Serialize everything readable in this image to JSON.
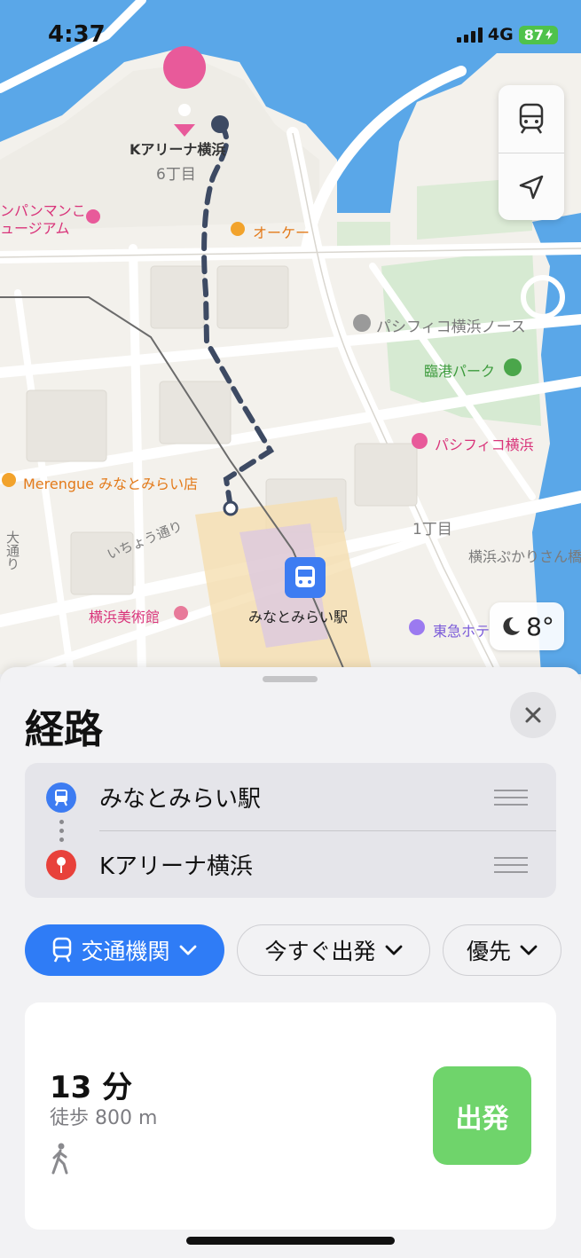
{
  "status_bar": {
    "time": "4:37",
    "network": "4G",
    "battery": "87"
  },
  "map": {
    "labels": {
      "arena": "Kアリーナ横浜",
      "block6": "6丁目",
      "museum_anpanman": "ンパンマンこ\nュージアム",
      "okay": "オーケー",
      "pacifico_north": "パシフィコ横浜ノース",
      "rinko_park": "臨港パーク",
      "pacifico": "パシフィコ横浜",
      "merengue": "Merengue みなとみらい店",
      "ichou_dori": "いちょう通り",
      "block1": "1丁目",
      "pukari": "横浜ぷかりさん橋",
      "art_museum": "横浜美術館",
      "station": "みなとみらい駅",
      "tokyu": "東急ホテ",
      "oodori": "大通り"
    },
    "weather": "8°"
  },
  "sheet": {
    "title": "経路",
    "route": {
      "from": "みなとみらい駅",
      "to": "Kアリーナ横浜"
    },
    "chips": {
      "mode": "交通機関",
      "depart": "今すぐ出発",
      "priority": "優先"
    },
    "result": {
      "duration": "13 分",
      "walk": "徒歩 800 m",
      "go_label": "出発"
    }
  },
  "colors": {
    "accent": "#2f7cf6",
    "go": "#6fd46b",
    "water": "#5aa7e8",
    "route": "#3d4a63"
  }
}
